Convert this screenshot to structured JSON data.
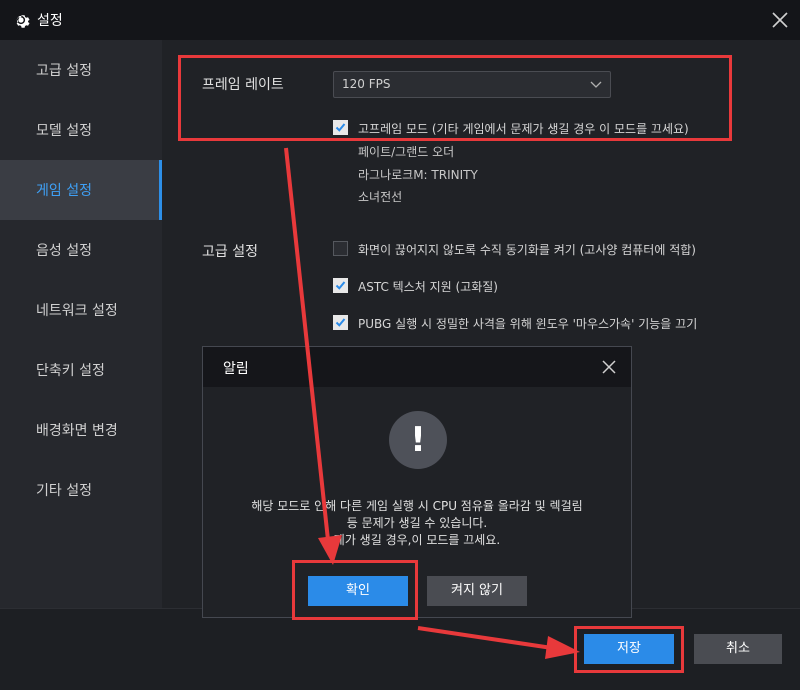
{
  "window": {
    "title": "설정"
  },
  "sidebar": {
    "items": [
      {
        "label": "고급 설정"
      },
      {
        "label": "모델 설정"
      },
      {
        "label": "게임 설정",
        "active": true
      },
      {
        "label": "음성 설정"
      },
      {
        "label": "네트워크 설정"
      },
      {
        "label": "단축키 설정"
      },
      {
        "label": "배경화면 변경"
      },
      {
        "label": "기타 설정"
      }
    ]
  },
  "main": {
    "frame_rate": {
      "label": "프레임 레이트",
      "selected": "120 FPS",
      "high_frame_mode": {
        "checked": true,
        "label": "고프레임 모드  (기타 게임에서 문제가 생길 경우 이 모드를 끄세요)"
      },
      "games": [
        "페이트/그랜드 오더",
        "라그나로크M: TRINITY",
        "소녀전선"
      ]
    },
    "advanced": {
      "label": "고급 설정",
      "options": [
        {
          "checked": false,
          "label": "화면이 끊어지지 않도록 수직 동기화를 켜기  (고사양 컴퓨터에 적합)"
        },
        {
          "checked": true,
          "label": "ASTC 텍스처 지원 (고화질)"
        },
        {
          "checked": true,
          "label": "PUBG 실행 시 정밀한 사격을 위해 윈도우 '마우스가속' 기능을 끄기"
        }
      ]
    }
  },
  "dialog": {
    "title": "알림",
    "icon": "exclamation-icon",
    "message_lines": [
      "해당 모드로 인해 다른 게임 실행 시 CPU 점유율 올라감 및 렉걸림",
      "등 문제가 생길 수 있습니다.",
      "제가 생길 경우,이 모드를 끄세요."
    ],
    "confirm_label": "확인",
    "cancel_label": "켜지 않기"
  },
  "footer": {
    "save_label": "저장",
    "cancel_label": "취소"
  },
  "colors": {
    "accent": "#2b8be8",
    "annotation": "#e8393b",
    "background": "#202226"
  }
}
